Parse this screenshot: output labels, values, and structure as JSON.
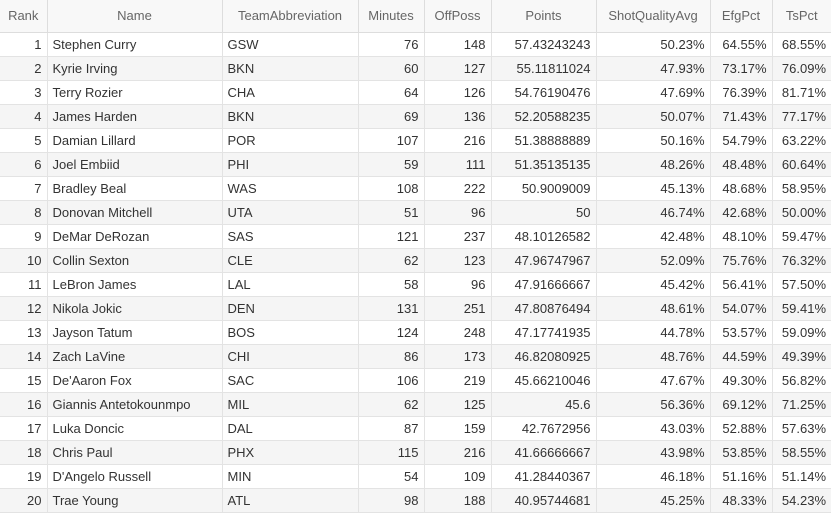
{
  "table": {
    "columns": [
      {
        "label": "Rank",
        "key": "rank",
        "align": "num",
        "name": "rank"
      },
      {
        "label": "Name",
        "key": "name",
        "align": "txt",
        "name": "name"
      },
      {
        "label": "TeamAbbreviation",
        "key": "team",
        "align": "txt",
        "name": "team-abbreviation"
      },
      {
        "label": "Minutes",
        "key": "minutes",
        "align": "num",
        "name": "minutes"
      },
      {
        "label": "OffPoss",
        "key": "offposs",
        "align": "num",
        "name": "offposs"
      },
      {
        "label": "Points",
        "key": "points",
        "align": "num",
        "name": "points"
      },
      {
        "label": "ShotQualityAvg",
        "key": "sqa",
        "align": "num",
        "name": "shot-quality-avg"
      },
      {
        "label": "EfgPct",
        "key": "efg",
        "align": "num",
        "name": "efg-pct"
      },
      {
        "label": "TsPct",
        "key": "ts",
        "align": "num",
        "name": "ts-pct"
      }
    ],
    "rows": [
      {
        "rank": "1",
        "name": "Stephen Curry",
        "team": "GSW",
        "minutes": "76",
        "offposs": "148",
        "points": "57.43243243",
        "sqa": "50.23%",
        "efg": "64.55%",
        "ts": "68.55%"
      },
      {
        "rank": "2",
        "name": "Kyrie Irving",
        "team": "BKN",
        "minutes": "60",
        "offposs": "127",
        "points": "55.11811024",
        "sqa": "47.93%",
        "efg": "73.17%",
        "ts": "76.09%"
      },
      {
        "rank": "3",
        "name": "Terry Rozier",
        "team": "CHA",
        "minutes": "64",
        "offposs": "126",
        "points": "54.76190476",
        "sqa": "47.69%",
        "efg": "76.39%",
        "ts": "81.71%"
      },
      {
        "rank": "4",
        "name": "James Harden",
        "team": "BKN",
        "minutes": "69",
        "offposs": "136",
        "points": "52.20588235",
        "sqa": "50.07%",
        "efg": "71.43%",
        "ts": "77.17%"
      },
      {
        "rank": "5",
        "name": "Damian Lillard",
        "team": "POR",
        "minutes": "107",
        "offposs": "216",
        "points": "51.38888889",
        "sqa": "50.16%",
        "efg": "54.79%",
        "ts": "63.22%"
      },
      {
        "rank": "6",
        "name": "Joel Embiid",
        "team": "PHI",
        "minutes": "59",
        "offposs": "111",
        "points": "51.35135135",
        "sqa": "48.26%",
        "efg": "48.48%",
        "ts": "60.64%"
      },
      {
        "rank": "7",
        "name": "Bradley Beal",
        "team": "WAS",
        "minutes": "108",
        "offposs": "222",
        "points": "50.9009009",
        "sqa": "45.13%",
        "efg": "48.68%",
        "ts": "58.95%"
      },
      {
        "rank": "8",
        "name": "Donovan Mitchell",
        "team": "UTA",
        "minutes": "51",
        "offposs": "96",
        "points": "50",
        "sqa": "46.74%",
        "efg": "42.68%",
        "ts": "50.00%"
      },
      {
        "rank": "9",
        "name": "DeMar DeRozan",
        "team": "SAS",
        "minutes": "121",
        "offposs": "237",
        "points": "48.10126582",
        "sqa": "42.48%",
        "efg": "48.10%",
        "ts": "59.47%"
      },
      {
        "rank": "10",
        "name": "Collin Sexton",
        "team": "CLE",
        "minutes": "62",
        "offposs": "123",
        "points": "47.96747967",
        "sqa": "52.09%",
        "efg": "75.76%",
        "ts": "76.32%"
      },
      {
        "rank": "11",
        "name": "LeBron James",
        "team": "LAL",
        "minutes": "58",
        "offposs": "96",
        "points": "47.91666667",
        "sqa": "45.42%",
        "efg": "56.41%",
        "ts": "57.50%"
      },
      {
        "rank": "12",
        "name": "Nikola Jokic",
        "team": "DEN",
        "minutes": "131",
        "offposs": "251",
        "points": "47.80876494",
        "sqa": "48.61%",
        "efg": "54.07%",
        "ts": "59.41%"
      },
      {
        "rank": "13",
        "name": "Jayson Tatum",
        "team": "BOS",
        "minutes": "124",
        "offposs": "248",
        "points": "47.17741935",
        "sqa": "44.78%",
        "efg": "53.57%",
        "ts": "59.09%"
      },
      {
        "rank": "14",
        "name": "Zach LaVine",
        "team": "CHI",
        "minutes": "86",
        "offposs": "173",
        "points": "46.82080925",
        "sqa": "48.76%",
        "efg": "44.59%",
        "ts": "49.39%"
      },
      {
        "rank": "15",
        "name": "De'Aaron Fox",
        "team": "SAC",
        "minutes": "106",
        "offposs": "219",
        "points": "45.66210046",
        "sqa": "47.67%",
        "efg": "49.30%",
        "ts": "56.82%"
      },
      {
        "rank": "16",
        "name": "Giannis Antetokounmpo",
        "team": "MIL",
        "minutes": "62",
        "offposs": "125",
        "points": "45.6",
        "sqa": "56.36%",
        "efg": "69.12%",
        "ts": "71.25%"
      },
      {
        "rank": "17",
        "name": "Luka Doncic",
        "team": "DAL",
        "minutes": "87",
        "offposs": "159",
        "points": "42.7672956",
        "sqa": "43.03%",
        "efg": "52.88%",
        "ts": "57.63%"
      },
      {
        "rank": "18",
        "name": "Chris Paul",
        "team": "PHX",
        "minutes": "115",
        "offposs": "216",
        "points": "41.66666667",
        "sqa": "43.98%",
        "efg": "53.85%",
        "ts": "58.55%"
      },
      {
        "rank": "19",
        "name": "D'Angelo Russell",
        "team": "MIN",
        "minutes": "54",
        "offposs": "109",
        "points": "41.28440367",
        "sqa": "46.18%",
        "efg": "51.16%",
        "ts": "51.14%"
      },
      {
        "rank": "20",
        "name": "Trae Young",
        "team": "ATL",
        "minutes": "98",
        "offposs": "188",
        "points": "40.95744681",
        "sqa": "45.25%",
        "efg": "48.33%",
        "ts": "54.23%"
      }
    ]
  }
}
